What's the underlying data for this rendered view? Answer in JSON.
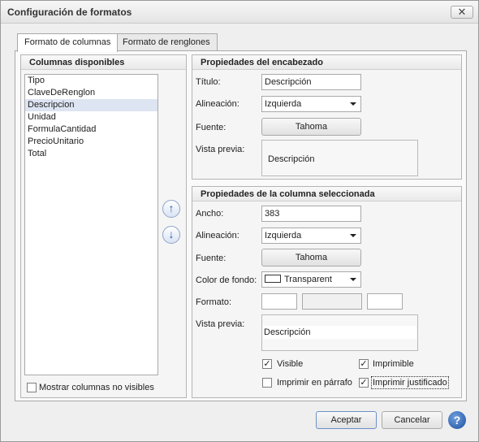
{
  "window": {
    "title": "Configuración de formatos",
    "close_icon": "close-icon"
  },
  "tabs": [
    {
      "label": "Formato de columnas",
      "active": true
    },
    {
      "label": "Formato de renglones",
      "active": false
    }
  ],
  "available_columns": {
    "header": "Columnas disponibles",
    "items": [
      "Tipo",
      "ClaveDeRenglon",
      "Descripcion",
      "Unidad",
      "FormulaCantidad",
      "PrecioUnitario",
      "Total"
    ],
    "selected": "Descripcion",
    "show_hidden_label": "Mostrar columnas no visibles",
    "show_hidden_checked": false
  },
  "move_buttons": {
    "up_icon": "arrow-up-icon",
    "down_icon": "arrow-down-icon"
  },
  "header_props": {
    "title": "Propiedades del encabezado",
    "titulo_label": "Título:",
    "titulo_value": "Descripción",
    "alineacion_label": "Alineación:",
    "alineacion_value": "Izquierda",
    "fuente_label": "Fuente:",
    "fuente_value": "Tahoma",
    "preview_label": "Vista previa:",
    "preview_text": "Descripción"
  },
  "column_props": {
    "title": "Propiedades de la columna seleccionada",
    "ancho_label": "Ancho:",
    "ancho_value": "383",
    "alineacion_label": "Alineación:",
    "alineacion_value": "Izquierda",
    "fuente_label": "Fuente:",
    "fuente_value": "Tahoma",
    "color_label": "Color de fondo:",
    "color_value": "Transparent",
    "formato_label": "Formato:",
    "formato_values": [
      "",
      "",
      ""
    ],
    "preview_label": "Vista previa:",
    "preview_text": "Descripción",
    "checks": {
      "visible_label": "Visible",
      "visible": true,
      "imprimible_label": "Imprimible",
      "imprimible": true,
      "parrafo_label": "Imprimir en párrafo",
      "parrafo": false,
      "justificado_label": "Imprimir justificado",
      "justificado": true
    }
  },
  "footer": {
    "accept_label": "Aceptar",
    "cancel_label": "Cancelar",
    "help_label": "?"
  },
  "colors": {
    "accent": "#6b91c9",
    "selection": "#dde4f2"
  }
}
